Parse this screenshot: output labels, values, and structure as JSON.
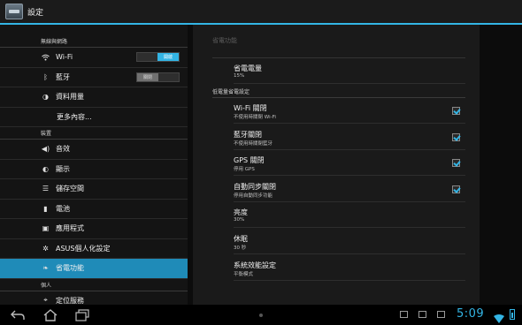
{
  "app": {
    "title": "設定"
  },
  "left": {
    "sections": [
      {
        "label": "無線與網路"
      },
      {
        "label": "裝置"
      },
      {
        "label": "個人"
      }
    ],
    "items": [
      {
        "label": "Wi-Fi",
        "icon": "wifi-icon",
        "toggle": "開啟"
      },
      {
        "label": "藍牙",
        "icon": "bluetooth-icon",
        "toggle": "關閉"
      },
      {
        "label": "資料用量",
        "icon": "data-usage-icon"
      },
      {
        "label": "更多內容..."
      },
      {
        "label": "音效",
        "icon": "sound-icon"
      },
      {
        "label": "顯示",
        "icon": "display-icon"
      },
      {
        "label": "儲存空間",
        "icon": "storage-icon"
      },
      {
        "label": "電池",
        "icon": "battery-icon"
      },
      {
        "label": "應用程式",
        "icon": "apps-icon"
      },
      {
        "label": "ASUS個人化設定",
        "icon": "asus-settings-icon"
      },
      {
        "label": "省電功能",
        "icon": "power-saving-icon",
        "selected": true
      },
      {
        "label": "定位服務",
        "icon": "location-icon"
      }
    ]
  },
  "right": {
    "title": "省電功能",
    "top_pref": {
      "title": "省電電量",
      "summary": "15%"
    },
    "category": "低電量省電設定",
    "prefs": [
      {
        "title": "Wi-Fi 關閉",
        "summary": "不使用時關閉 Wi-Fi",
        "checked": true
      },
      {
        "title": "藍牙關閉",
        "summary": "不使用時關閉藍牙",
        "checked": true
      },
      {
        "title": "GPS 關閉",
        "summary": "停用 GPS",
        "checked": true
      },
      {
        "title": "自動同步關閉",
        "summary": "停用自動同步功能",
        "checked": true
      },
      {
        "title": "亮度",
        "summary": "30%"
      },
      {
        "title": "休眠",
        "summary": "30 秒"
      },
      {
        "title": "系統效能設定",
        "summary": "平衡模式"
      }
    ]
  },
  "statusbar": {
    "time": "5:09"
  },
  "colors": {
    "accent": "#33b5e5",
    "selected": "#1f8bb8"
  }
}
